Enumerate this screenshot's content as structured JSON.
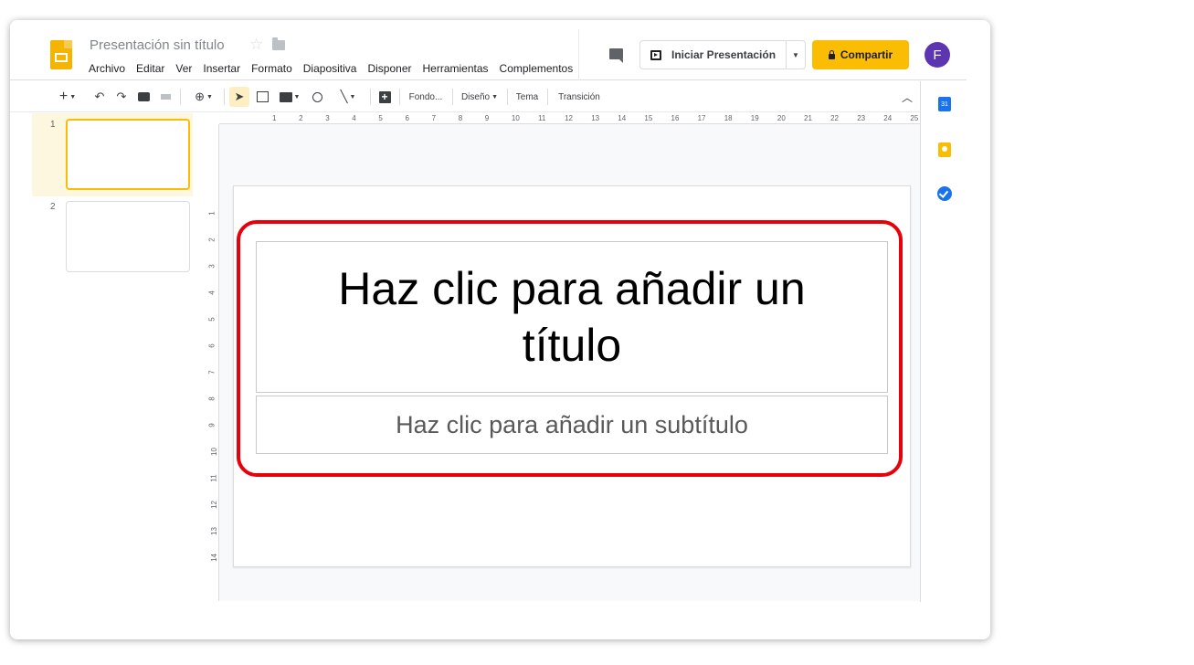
{
  "doc": {
    "title": "Presentación sin título"
  },
  "menu": [
    "Archivo",
    "Editar",
    "Ver",
    "Insertar",
    "Formato",
    "Diapositiva",
    "Disponer",
    "Herramientas",
    "Complementos"
  ],
  "header": {
    "present_label": "Iniciar Presentación",
    "share_label": "Compartir",
    "avatar_initial": "F"
  },
  "toolbar": {
    "fondo": "Fondo...",
    "diseno": "Diseño",
    "tema": "Tema",
    "transicion": "Transición"
  },
  "slides": [
    {
      "number": "1",
      "selected": true
    },
    {
      "number": "2",
      "selected": false
    }
  ],
  "ruler": {
    "h": [
      "1",
      "2",
      "3",
      "4",
      "5",
      "6",
      "7",
      "8",
      "9",
      "10",
      "11",
      "12",
      "13",
      "14",
      "15",
      "16",
      "17",
      "18",
      "19",
      "20",
      "21",
      "22",
      "23",
      "24",
      "25"
    ],
    "v": [
      "1",
      "2",
      "3",
      "4",
      "5",
      "6",
      "7",
      "8",
      "9",
      "10",
      "11",
      "12",
      "13",
      "14"
    ]
  },
  "slide_content": {
    "title": "Haz clic para añadir un título",
    "subtitle": "Haz clic para añadir un subtítulo"
  },
  "side_panel": {
    "calendar_day": "31"
  },
  "colors": {
    "accent": "#fbbc04",
    "highlight": "#e8000b",
    "avatar": "#5e35b1"
  }
}
